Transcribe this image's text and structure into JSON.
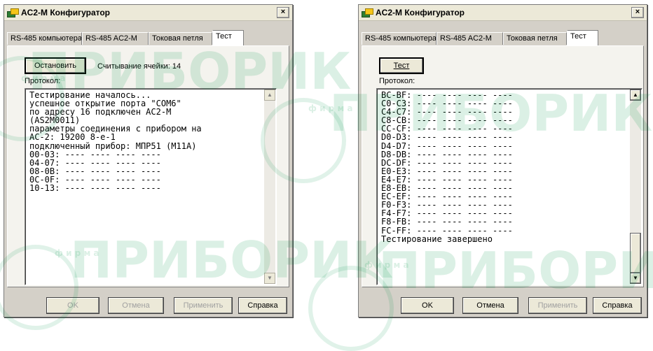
{
  "window_title": "AC2-M Конфигуратор",
  "tabs": [
    "RS-485 компьютера",
    "RS-485 AC2-M",
    "Токовая петля",
    "Тест"
  ],
  "left": {
    "stop_button": "Остановить",
    "status": "Считывание ячейки: 14",
    "protocol_label": "Протокол:",
    "log_lines": [
      "Тестирование началось...",
      "успешное открытие порта \"COM6\"",
      "по адресу 16 подключен AC2-M",
      "(AS2M0011)",
      "параметры соединения с прибором на",
      "AC-2: 19200 8-e-1",
      "подключенный прибор: МПР51 (M11A)",
      "00-03: ---- ---- ---- ----",
      "04-07: ---- ---- ---- ----",
      "08-0B: ---- ---- ---- ----",
      "0C-0F: ---- ---- ---- ----",
      "10-13: ---- ---- ---- ----"
    ]
  },
  "right": {
    "test_button": "Тест",
    "protocol_label": "Протокол:",
    "log_lines": [
      "BC-BF: ---- ---- ---- ----",
      "C0-C3: ---- ---- ---- ----",
      "C4-C7: ---- ---- ---- ----",
      "C8-CB: ---- ---- ---- ----",
      "CC-CF: ---- ---- ---- ----",
      "D0-D3: ---- ---- ---- ----",
      "D4-D7: ---- ---- ---- ----",
      "D8-DB: ---- ---- ---- ----",
      "DC-DF: ---- ---- ---- ----",
      "E0-E3: ---- ---- ---- ----",
      "E4-E7: ---- ---- ---- ----",
      "E8-EB: ---- ---- ---- ----",
      "EC-EF: ---- ---- ---- ----",
      "F0-F3: ---- ---- ---- ----",
      "F4-F7: ---- ---- ---- ----",
      "F8-FB: ---- ---- ---- ----",
      "FC-FF: ---- ---- ---- ----",
      "Тестирование завершено"
    ]
  },
  "footer": {
    "ok": "OK",
    "cancel": "Отмена",
    "apply": "Применить",
    "help": "Справка"
  },
  "close_glyph": "×",
  "watermark": {
    "prefix": "ф и р м а",
    "brand": "ПРИБОРИК"
  },
  "colors": {
    "watermark": "#00964a",
    "active_tab": "#ffffff",
    "face": "#d4d0c8"
  }
}
